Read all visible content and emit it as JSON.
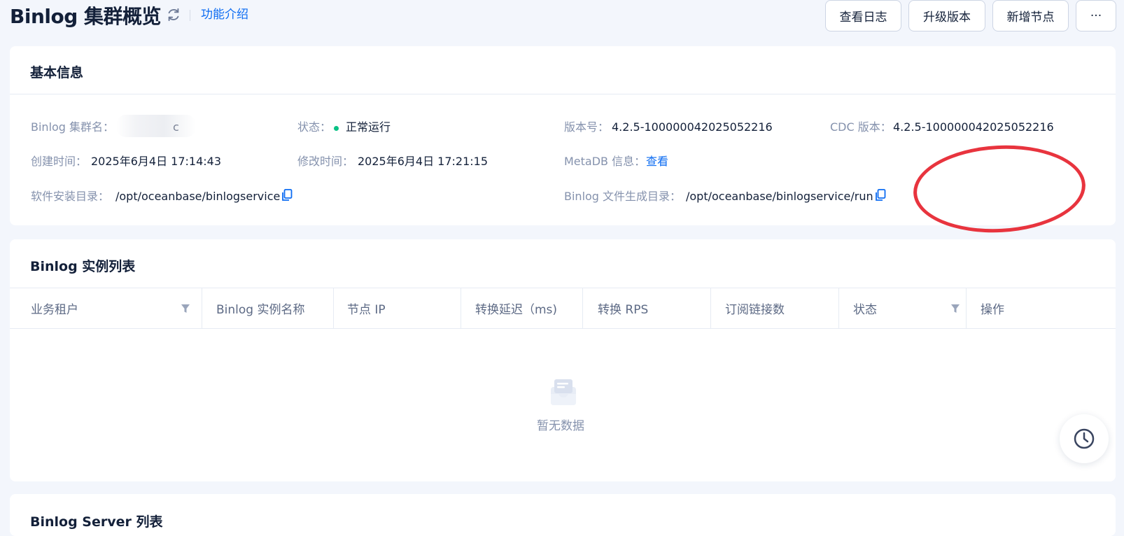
{
  "header": {
    "title": "Binlog 集群概览",
    "intro_link": "功能介绍",
    "buttons": {
      "view_logs": "查看日志",
      "upgrade": "升级版本",
      "add_node": "新增节点",
      "more": "···"
    }
  },
  "basic_info": {
    "title": "基本信息",
    "cluster_name": {
      "label": "Binlog 集群名：",
      "value": "c"
    },
    "status": {
      "label": "状态：",
      "value": "正常运行"
    },
    "version": {
      "label": "版本号：",
      "value": "4.2.5-100000042025052216"
    },
    "cdc_version": {
      "label": "CDC 版本：",
      "value": "4.2.5-100000042025052216"
    },
    "created_at": {
      "label": "创建时间：",
      "value": "2025年6月4日 17:14:43"
    },
    "modified_at": {
      "label": "修改时间：",
      "value": "2025年6月4日 17:21:15"
    },
    "metadb": {
      "label": "MetaDB 信息：",
      "link": "查看"
    },
    "install_dir": {
      "label": "软件安装目录：",
      "value": "/opt/oceanbase/binlogservice"
    },
    "binlog_dir": {
      "label": "Binlog 文件生成目录：",
      "value": "/opt/oceanbase/binlogservice/run"
    }
  },
  "instance_list": {
    "title": "Binlog 实例列表",
    "columns": [
      "业务租户",
      "Binlog 实例名称",
      "节点 IP",
      "转换延迟（ms)",
      "转换 RPS",
      "订阅链接数",
      "状态",
      "操作"
    ],
    "empty_text": "暂无数据"
  },
  "server_list": {
    "title": "Binlog Server 列表"
  },
  "colors": {
    "primary": "#0d6cf2",
    "status_ok": "#0ac185",
    "annotation": "#e8343e"
  }
}
